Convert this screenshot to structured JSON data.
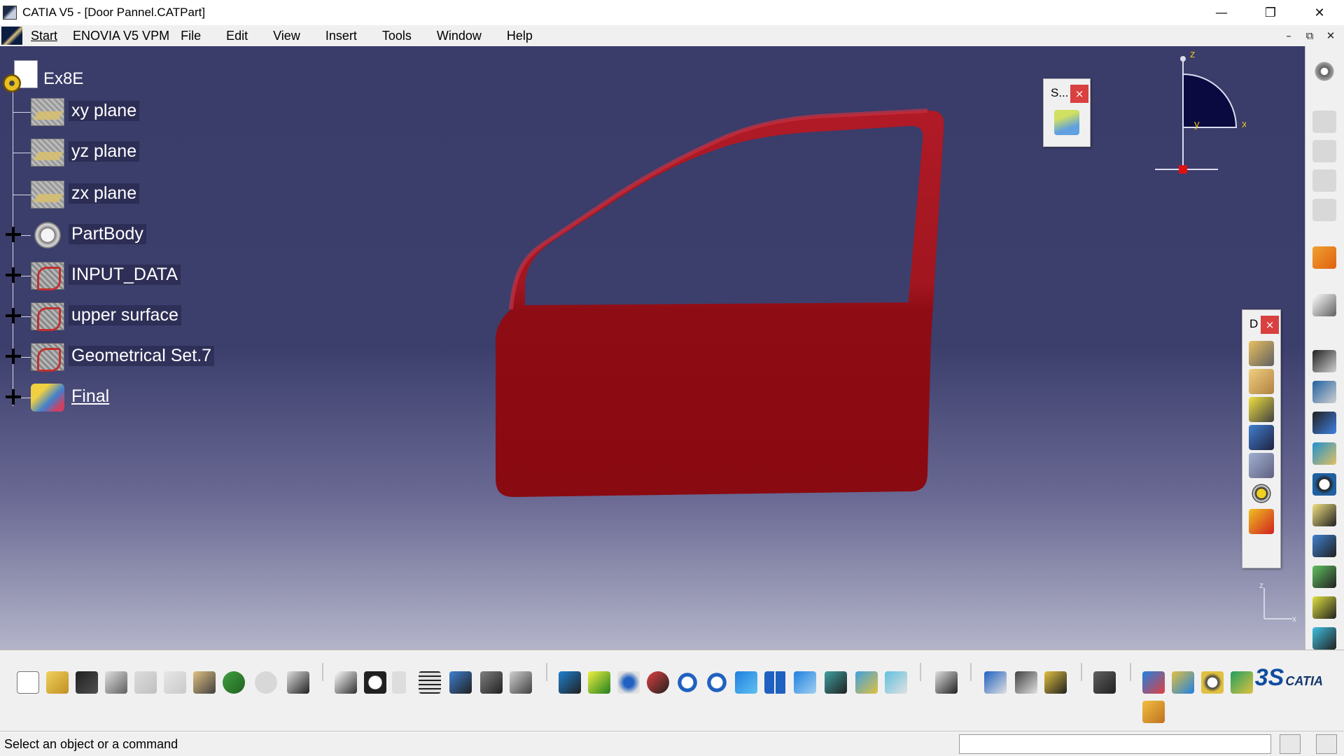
{
  "window": {
    "title": "CATIA V5 - [Door Pannel.CATPart]",
    "controls": {
      "minimize": "—",
      "restore": "❐",
      "close": "✕"
    }
  },
  "menu": {
    "items": [
      "Start",
      "ENOVIA V5 VPM",
      "File",
      "Edit",
      "View",
      "Insert",
      "Tools",
      "Window",
      "Help"
    ],
    "doc_controls": {
      "minimize": "–",
      "restore": "⧉",
      "close": "✕"
    }
  },
  "tree": {
    "root": "Ex8E",
    "items": [
      {
        "label": "xy plane",
        "icon": "plane-icon",
        "expandable": false
      },
      {
        "label": "yz plane",
        "icon": "plane-icon",
        "expandable": false
      },
      {
        "label": "zx plane",
        "icon": "plane-icon",
        "expandable": false
      },
      {
        "label": "PartBody",
        "icon": "partbody-icon",
        "expandable": true
      },
      {
        "label": "INPUT_DATA",
        "icon": "geometrical-set-icon",
        "expandable": true
      },
      {
        "label": "upper surface",
        "icon": "geometrical-set-icon",
        "expandable": true
      },
      {
        "label": "Geometrical Set.7",
        "icon": "geometrical-set-icon",
        "expandable": true
      },
      {
        "label": "Final",
        "icon": "final-set-icon",
        "expandable": true
      }
    ]
  },
  "compass": {
    "z": "z",
    "y": "y",
    "x": "x"
  },
  "axis_mini": {
    "z": "z",
    "x": "x"
  },
  "float_s": {
    "title": "S...",
    "close": "×"
  },
  "float_d": {
    "title": "D",
    "close": "×"
  },
  "status": {
    "message": "Select an object or a command"
  },
  "brand": {
    "ds": "3S",
    "name": "CATIA"
  },
  "colors": {
    "door": "#a01520",
    "viewport_top": "#3a3c6a",
    "viewport_bottom": "#b3b4c9"
  }
}
